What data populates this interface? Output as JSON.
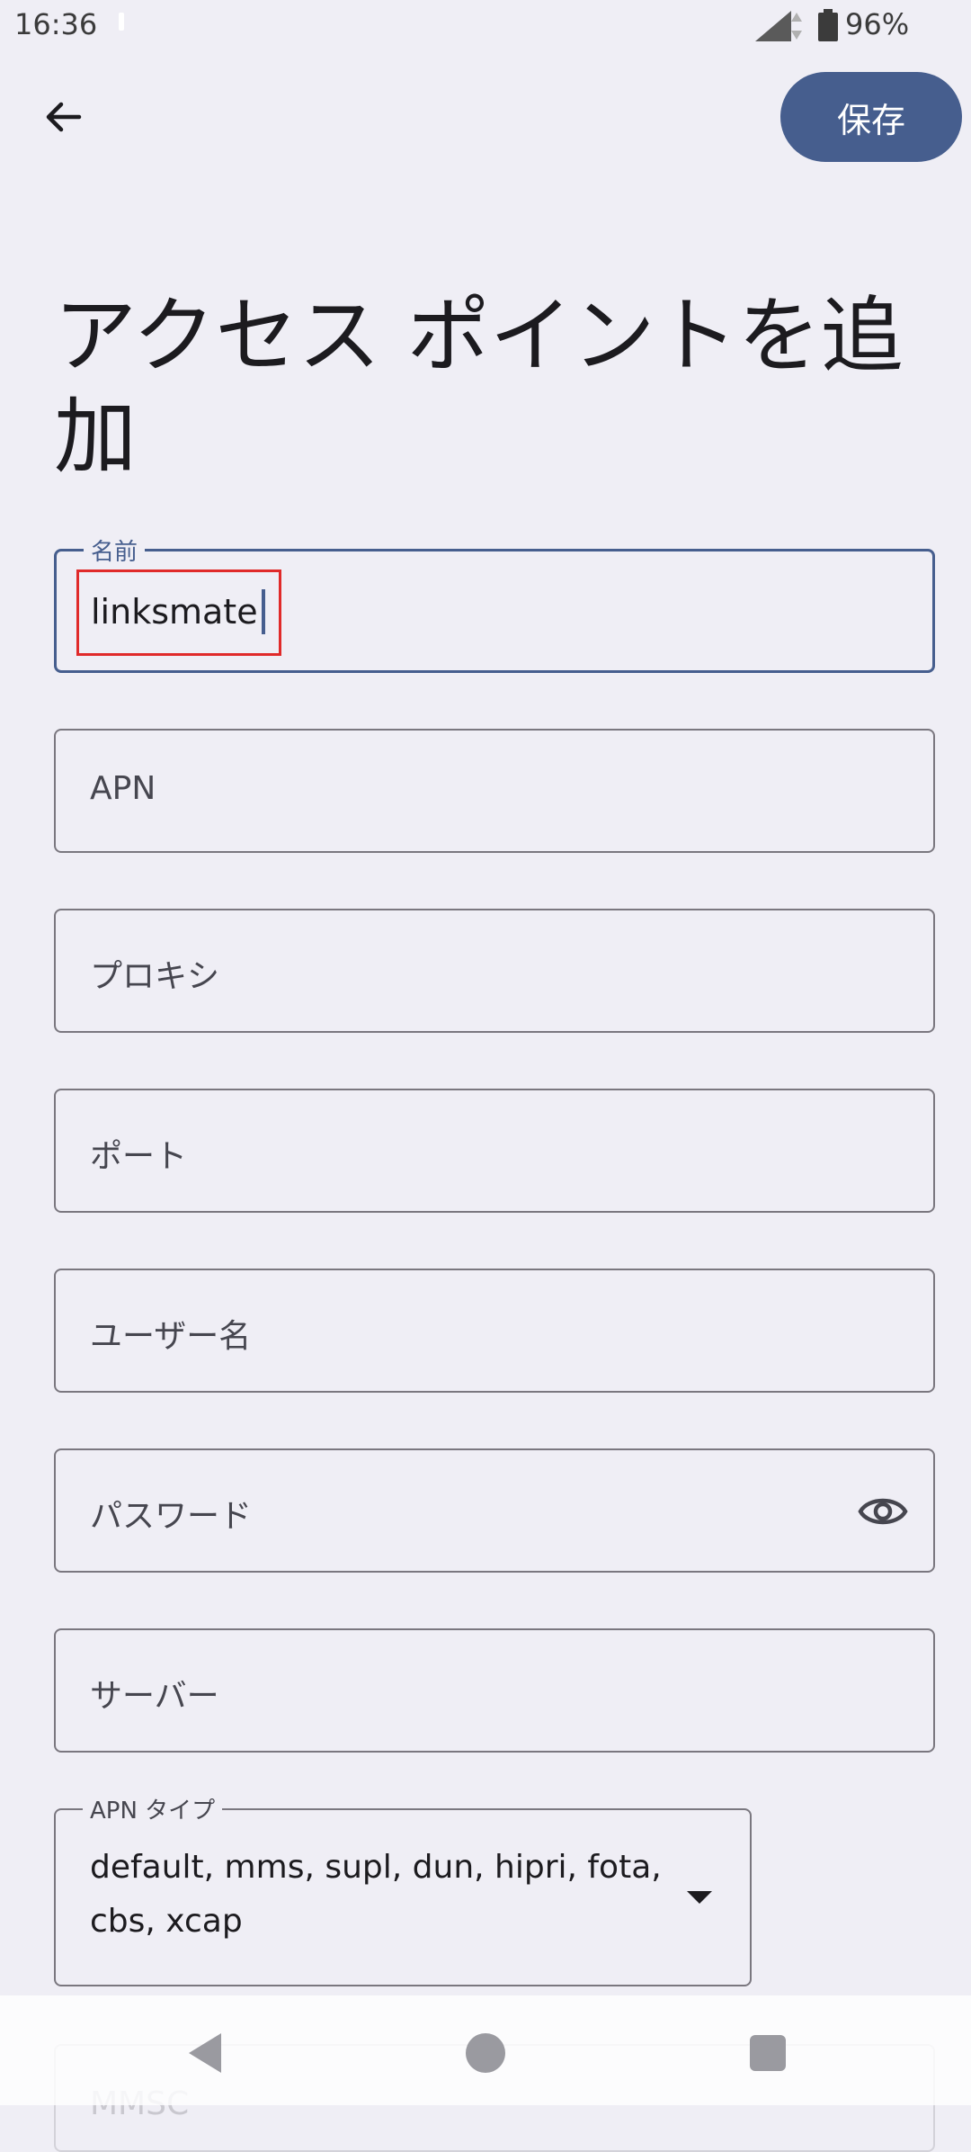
{
  "status_bar": {
    "time": "16:36",
    "battery": "96%"
  },
  "header": {
    "save_label": "保存"
  },
  "title": "アクセス ポイントを追加",
  "fields": {
    "name": {
      "label": "名前",
      "value": "linksmate"
    },
    "apn": {
      "placeholder": "APN"
    },
    "proxy": {
      "placeholder": "プロキシ"
    },
    "port": {
      "placeholder": "ポート"
    },
    "username": {
      "placeholder": "ユーザー名"
    },
    "password": {
      "placeholder": "パスワード"
    },
    "server": {
      "placeholder": "サーバー"
    },
    "apn_type": {
      "label": "APN タイプ",
      "value": "default, mms, supl, dun, hipri, fota, cbs, xcap"
    },
    "mmsc": {
      "placeholder": "MMSC"
    }
  },
  "colors": {
    "accent": "#465e8e",
    "background": "#efeef5",
    "highlight": "#e02a2a"
  },
  "icons": {
    "back": "arrow-back-icon",
    "password_toggle": "eye-icon"
  }
}
